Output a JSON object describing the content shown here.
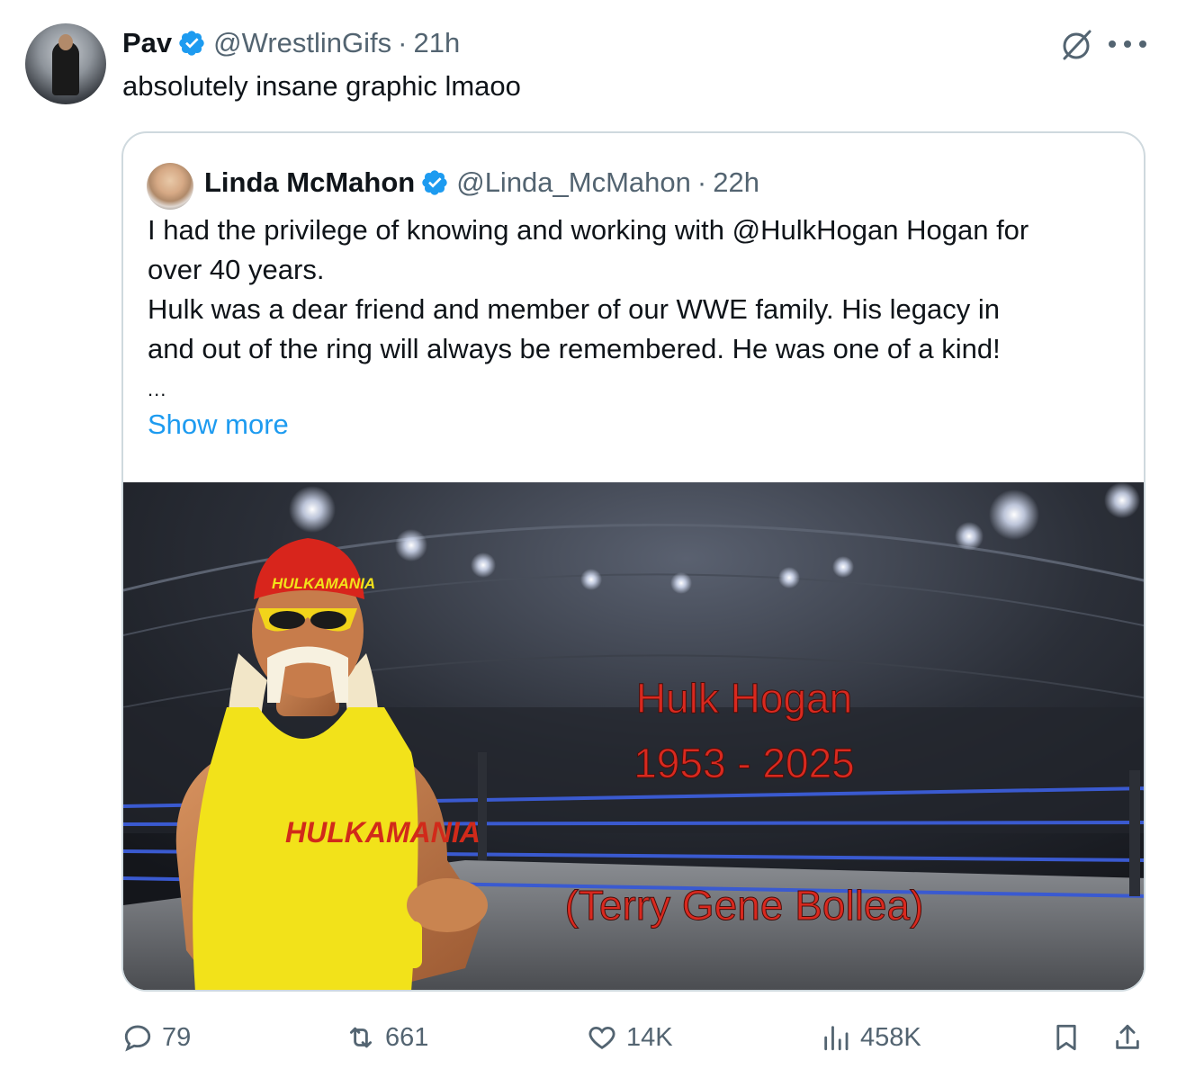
{
  "tweet": {
    "author_name": "Pav",
    "handle": "@WrestlinGifs",
    "separator": "·",
    "time": "21h",
    "text": "absolutely insane graphic lmaoo"
  },
  "quote": {
    "author_name": "Linda McMahon",
    "handle": "@Linda_McMahon",
    "separator": "·",
    "time": "22h",
    "lines": [
      "I had the privilege of knowing and working with @HulkHogan Hogan for",
      "over 40 years.",
      "Hulk was a dear friend and member of our WWE family. His legacy in",
      "and out of the ring will always be remembered.  He was one of a kind!"
    ],
    "ellipsis": "...",
    "show_more": "Show more",
    "image": {
      "title": "Hulk Hogan",
      "years": "1953 - 2025",
      "subtitle": "(Terry Gene Bollea)",
      "bandana_text": "HULKAMANIA",
      "shirt_text": "HULKAMANIA"
    }
  },
  "actions": {
    "replies": "79",
    "reposts": "661",
    "likes": "14K",
    "views": "458K"
  },
  "colors": {
    "accent": "#1d9bf0",
    "secondary_text": "#536471",
    "border": "#cfd9de",
    "overlay_text": "#d9291f"
  },
  "icons": [
    "verified-badge-icon",
    "grok-icon",
    "more-icon",
    "reply-icon",
    "repost-icon",
    "like-icon",
    "views-icon",
    "bookmark-icon",
    "share-icon"
  ]
}
